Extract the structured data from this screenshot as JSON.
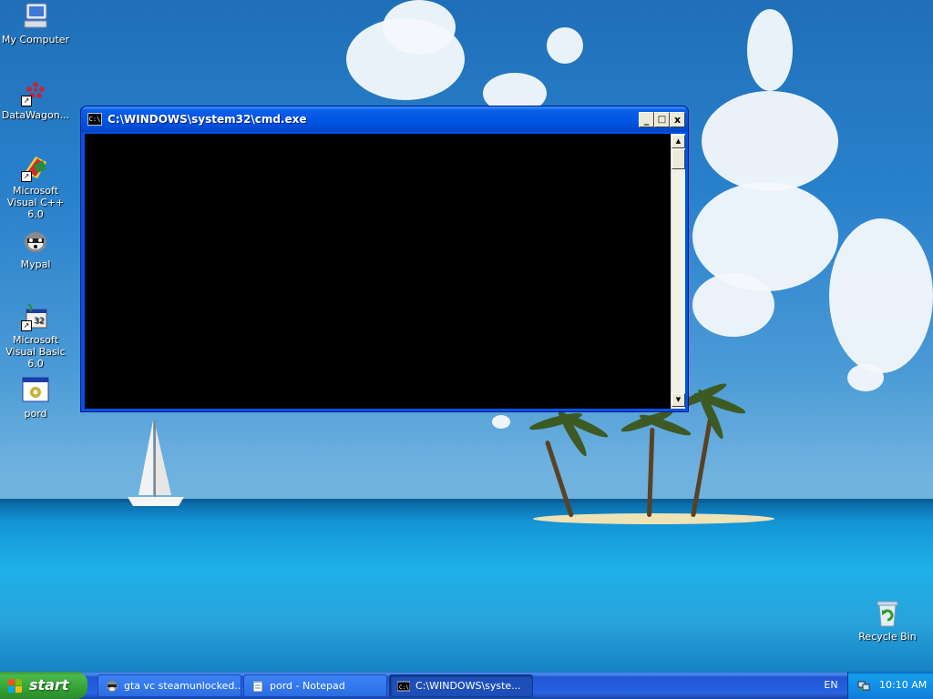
{
  "desktop": {
    "icons": [
      {
        "label": "My Computer",
        "icon": "my-computer-icon"
      },
      {
        "label": "DataWagon...",
        "icon": "datawagon-icon"
      },
      {
        "label": "Microsoft Visual C++ 6.0",
        "icon": "visual-cpp-icon"
      },
      {
        "label": "Mypal",
        "icon": "mypal-icon"
      },
      {
        "label": "Microsoft Visual Basic 6.0",
        "icon": "visual-basic-icon"
      },
      {
        "label": "pord",
        "icon": "pord-icon"
      },
      {
        "label": "Recycle Bin",
        "icon": "recycle-bin-icon"
      }
    ]
  },
  "window": {
    "title": "C:\\WINDOWS\\system32\\cmd.exe",
    "icon": "cmd-icon",
    "buttons": {
      "minimize": "_",
      "maximize": "□",
      "close": "x"
    },
    "console_text": ""
  },
  "taskbar": {
    "start_label": "start",
    "tasks": [
      {
        "label": "gta vc steamunlocked...",
        "icon": "mypal-icon",
        "active": false
      },
      {
        "label": "pord - Notepad",
        "icon": "notepad-icon",
        "active": false
      },
      {
        "label": "C:\\WINDOWS\\syste...",
        "icon": "cmd-icon",
        "active": true
      }
    ],
    "language": "EN",
    "clock": "10:10 AM"
  },
  "colors": {
    "taskbar_blue": "#2663e0",
    "start_green": "#36a336",
    "titlebar_blue": "#0054e3",
    "console_bg": "#000000"
  }
}
